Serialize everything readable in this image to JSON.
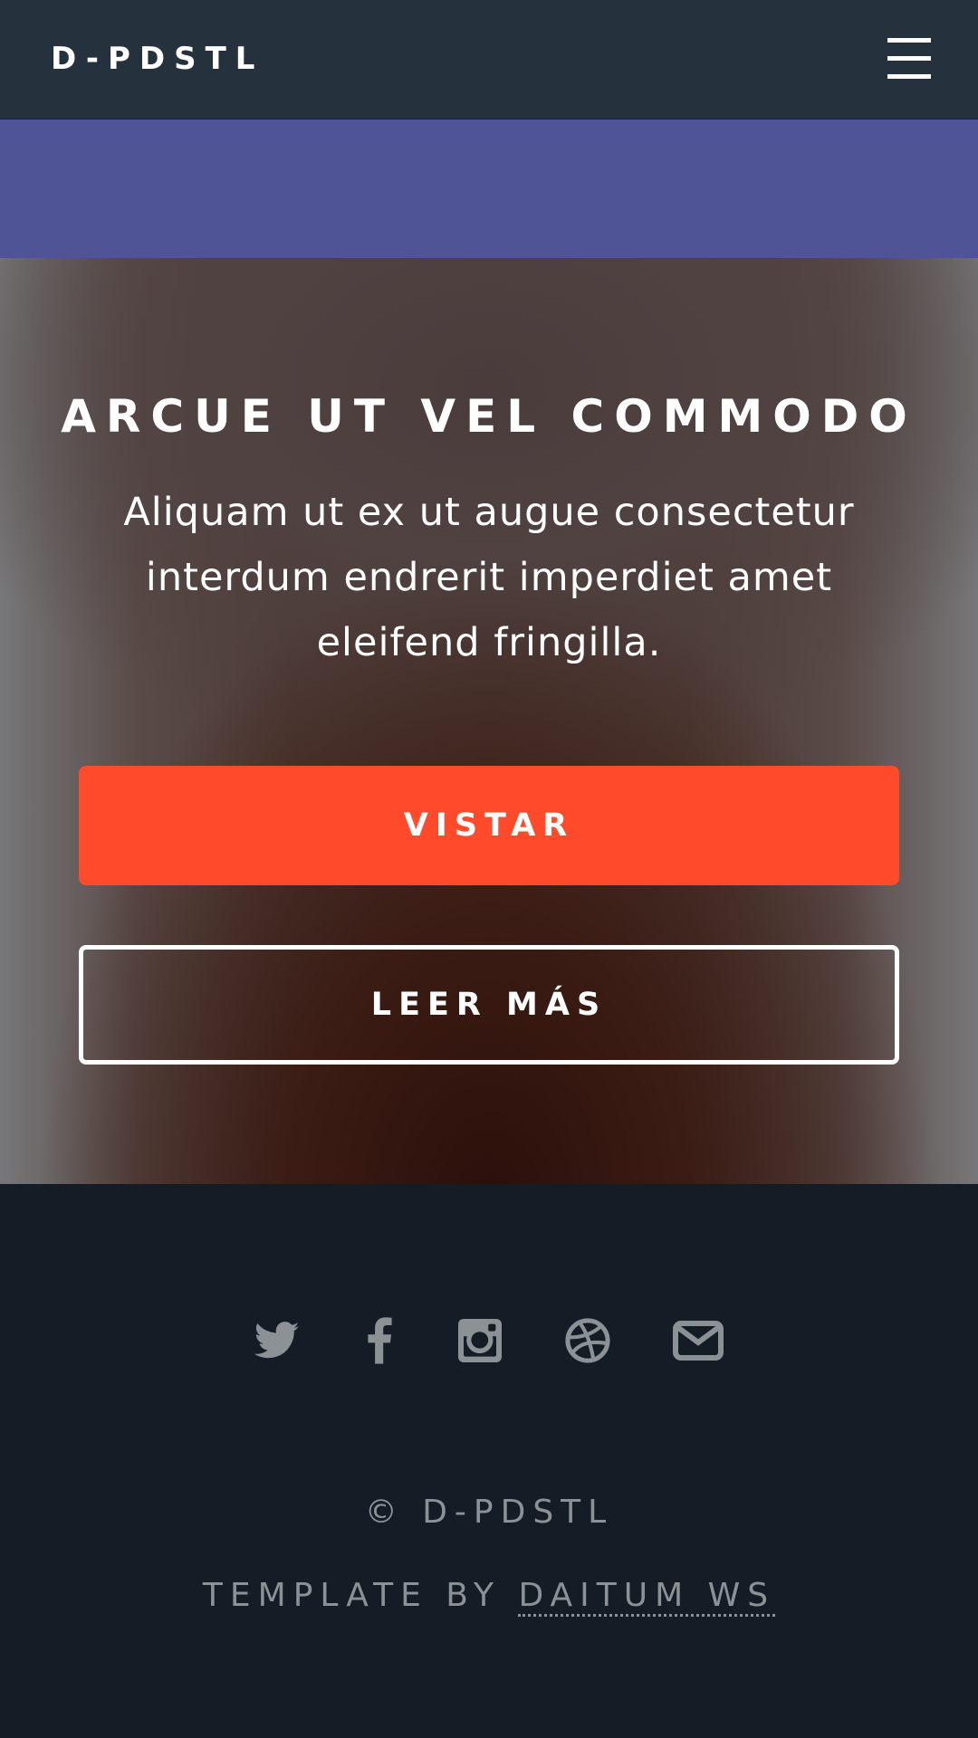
{
  "header": {
    "brand": "D-PDSTL",
    "menu_icon": "hamburger-menu-icon"
  },
  "hero": {
    "title": "ARCUE UT VEL COMMODO",
    "text": "Aliquam ut ex ut augue consectetur interdum endrerit imperdiet amet eleifend fringilla.",
    "primary_button": "VISTAR",
    "secondary_button": "LEER MÁS"
  },
  "footer": {
    "social_icons": [
      "twitter-icon",
      "facebook-icon",
      "instagram-icon",
      "dribbble-icon",
      "envelope-icon"
    ],
    "copyright": "© D-PDSTL",
    "credits_prefix": "TEMPLATE BY ",
    "credits_link": "DAITUM WS"
  },
  "colors": {
    "header_bg": "#25323d",
    "band_bg": "#4f5497",
    "primary_button_bg": "#ff4a2c",
    "footer_bg": "#141d25",
    "footer_text": "#8c9196"
  }
}
